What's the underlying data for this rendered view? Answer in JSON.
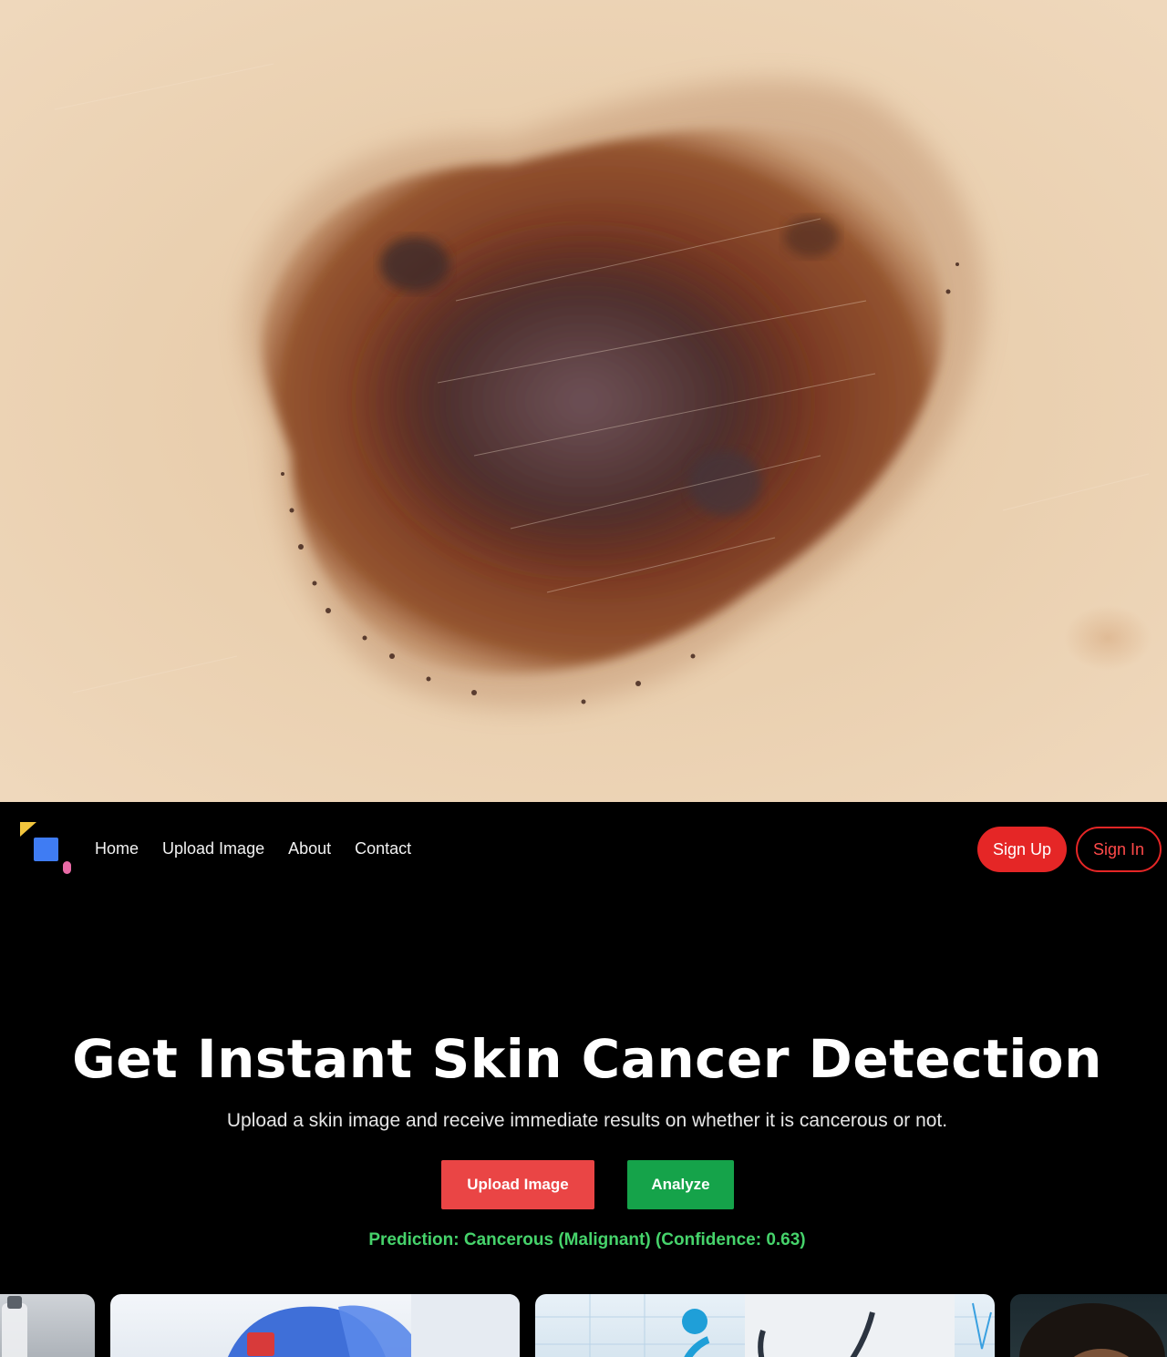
{
  "uploaded_image": {
    "subject": "skin-lesion-photo"
  },
  "nav": {
    "logo_icon": "brand-logo-icon",
    "links": [
      "Home",
      "Upload Image",
      "About",
      "Contact"
    ],
    "signup_label": "Sign Up",
    "signin_label": "Sign In"
  },
  "hero": {
    "title": "Get Instant Skin Cancer Detection",
    "subtitle": "Upload a skin image and receive immediate results on whether it is cancerous or not.",
    "upload_label": "Upload Image",
    "analyze_label": "Analyze",
    "prediction": "Prediction: Cancerous (Malignant) (Confidence: 0.63)"
  },
  "colors": {
    "background": "#000000",
    "signup": "#e52626",
    "upload_button": "#ea4545",
    "analyze_button": "#15a34a",
    "prediction_text": "#46d36b"
  }
}
